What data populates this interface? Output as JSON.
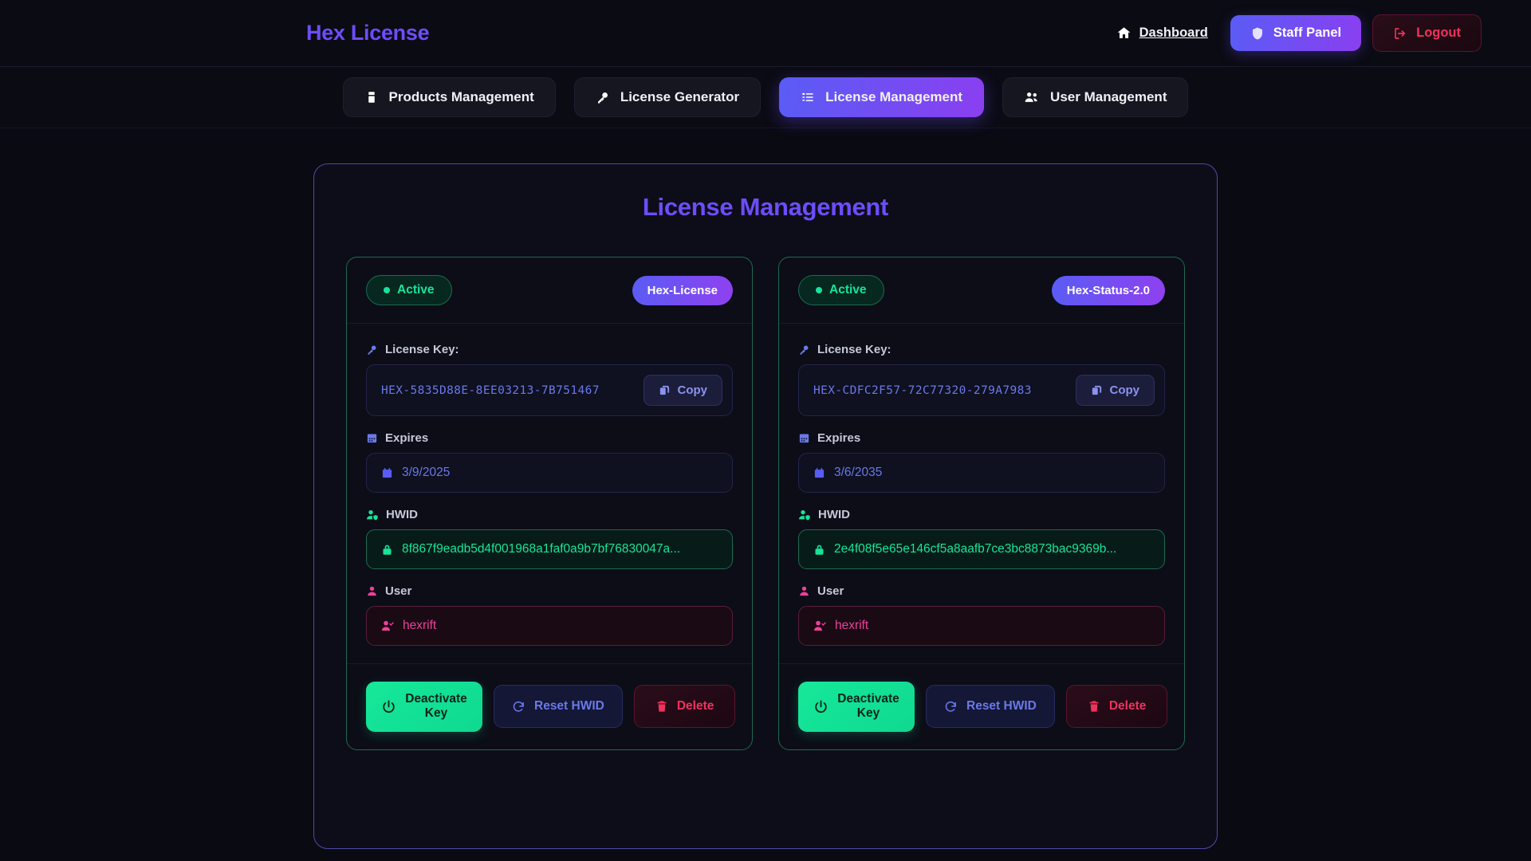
{
  "header": {
    "brand": "Hex License",
    "dashboard_label": "Dashboard",
    "dashboard_icon": "home-icon",
    "staff_panel_label": "Staff Panel",
    "staff_panel_icon": "shield-icon",
    "logout_label": "Logout",
    "logout_icon": "logout-icon",
    "accent_purple": "#6d4dfa",
    "accent_red": "#f0325e"
  },
  "tabs": [
    {
      "label": "Products Management",
      "icon": "package-icon",
      "active": false
    },
    {
      "label": "License Generator",
      "icon": "key-icon",
      "active": false
    },
    {
      "label": "License Management",
      "icon": "list-icon",
      "active": true
    },
    {
      "label": "User Management",
      "icon": "users-icon",
      "active": false
    }
  ],
  "panel": {
    "title": "License Management"
  },
  "labels": {
    "license_key": "License Key:",
    "expires": "Expires",
    "hwid": "HWID",
    "user": "User",
    "copy": "Copy",
    "deactivate": "Deactivate Key",
    "reset_hwid": "Reset HWID",
    "delete": "Delete",
    "key_icon": "key-icon",
    "calendar_icon": "calendar-icon",
    "shield-user_icon": "user-shield-icon",
    "user_icon": "user-icon",
    "lock_icon": "lock-icon",
    "user_check_icon": "user-check-icon",
    "copy_icon": "copy-icon",
    "power_icon": "power-icon",
    "refresh_icon": "refresh-icon",
    "trash_icon": "trash-icon"
  },
  "licenses": [
    {
      "status": "Active",
      "status_color": "#18e39a",
      "product": "Hex-License",
      "license_key": "HEX-5835D88E-8EE03213-7B751467",
      "expires": "3/9/2025",
      "hwid": "8f867f9eadb5d4f001968a1faf0a9b7bf76830047a...",
      "user": "hexrift"
    },
    {
      "status": "Active",
      "status_color": "#18e39a",
      "product": "Hex-Status-2.0",
      "license_key": "HEX-CDFC2F57-72C77320-279A7983",
      "expires": "3/6/2035",
      "hwid": "2e4f08f5e65e146cf5a8aafb7ce3bc8873bac9369b...",
      "user": "hexrift"
    }
  ]
}
